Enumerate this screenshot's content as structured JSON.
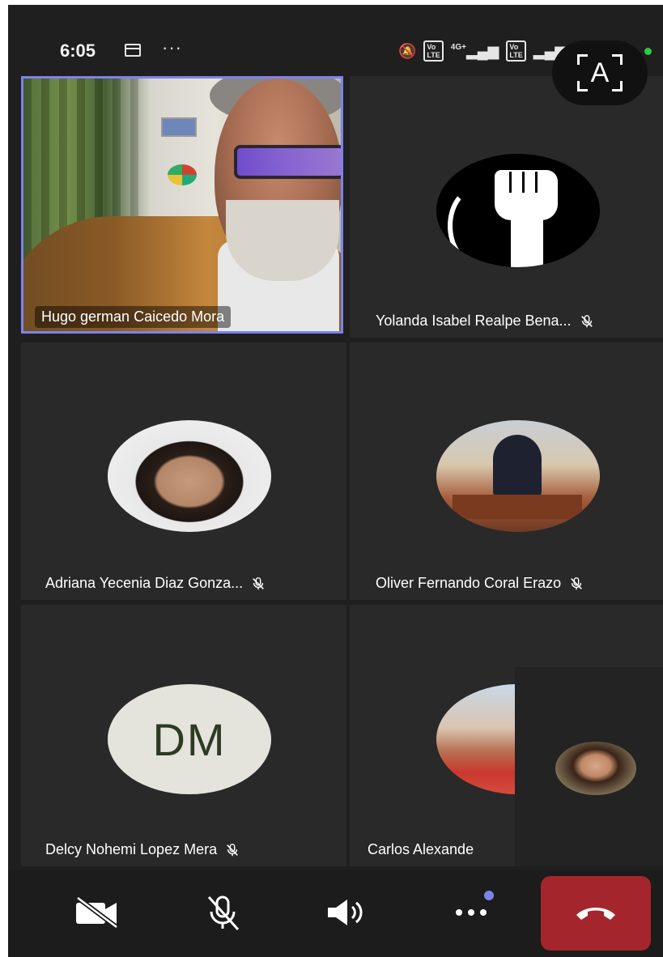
{
  "status_bar": {
    "time": "6:05",
    "more": "···",
    "icons": [
      "mute-notification-icon",
      "volte-icon",
      "4g-signal-icon",
      "volte-icon",
      "signal-icon",
      "battery-icon"
    ],
    "network_label": "4G+",
    "volte_label": "Vo LTE"
  },
  "translate_button": {
    "label": "A",
    "icon": "translate-scan-icon"
  },
  "participants": [
    {
      "name": "Hugo german Caicedo Mora",
      "muted": false,
      "view": "video",
      "active_speaker": true
    },
    {
      "name": "Yolanda Isabel Realpe Bena...",
      "muted": true,
      "view": "avatar-image"
    },
    {
      "name": "Adriana Yecenia Diaz Gonza...",
      "muted": true,
      "view": "avatar-image"
    },
    {
      "name": "Oliver Fernando Coral Erazo",
      "muted": true,
      "view": "avatar-image"
    },
    {
      "name": "Delcy Nohemi Lopez Mera",
      "muted": true,
      "view": "initials",
      "initials": "DM"
    },
    {
      "name": "Carlos Alexande",
      "muted": false,
      "view": "avatar-image"
    }
  ],
  "controls": {
    "camera": "camera-off-icon",
    "microphone": "mic-off-icon",
    "speaker": "speaker-icon",
    "more": "more-icon",
    "hangup": "hang-up-icon"
  },
  "colors": {
    "background": "#1f1f1f",
    "tile": "#292929",
    "active_border": "#7b83eb",
    "hangup": "#a4262c",
    "text": "#ffffff"
  }
}
